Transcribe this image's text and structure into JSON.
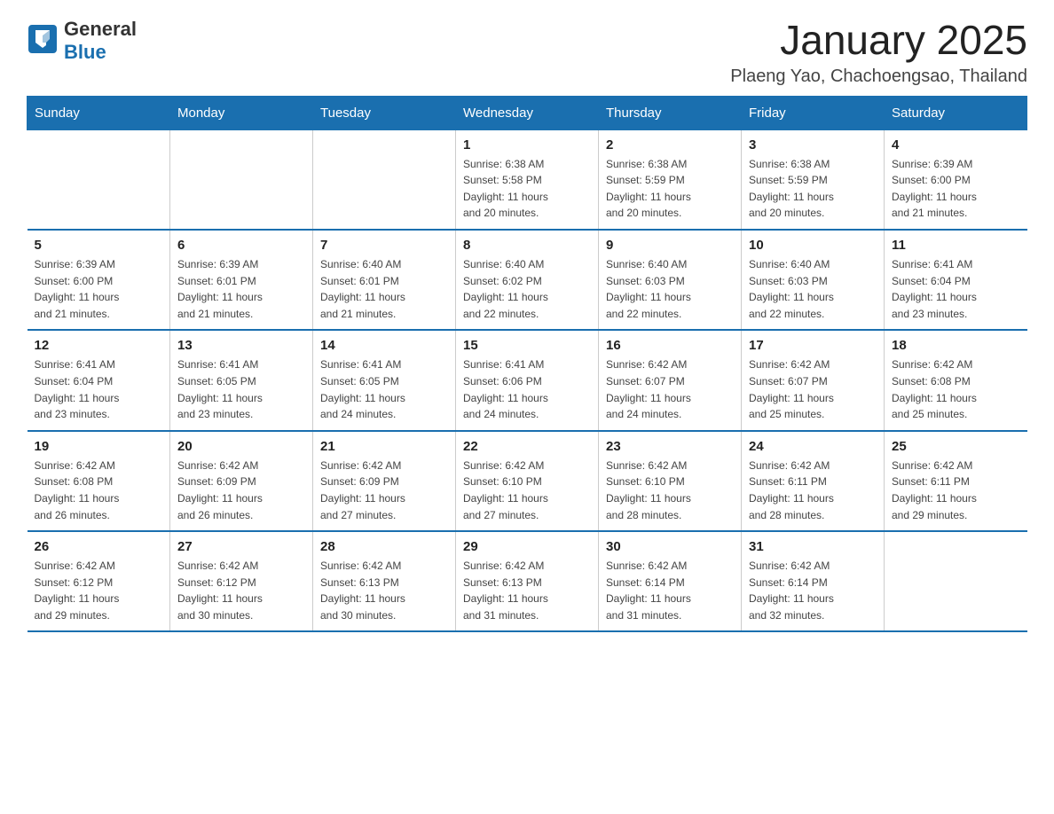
{
  "header": {
    "logo": {
      "text_general": "General",
      "text_blue": "Blue"
    },
    "title": "January 2025",
    "subtitle": "Plaeng Yao, Chachoengsao, Thailand"
  },
  "days_of_week": [
    "Sunday",
    "Monday",
    "Tuesday",
    "Wednesday",
    "Thursday",
    "Friday",
    "Saturday"
  ],
  "weeks": [
    {
      "days": [
        {
          "number": "",
          "info": ""
        },
        {
          "number": "",
          "info": ""
        },
        {
          "number": "",
          "info": ""
        },
        {
          "number": "1",
          "info": "Sunrise: 6:38 AM\nSunset: 5:58 PM\nDaylight: 11 hours\nand 20 minutes."
        },
        {
          "number": "2",
          "info": "Sunrise: 6:38 AM\nSunset: 5:59 PM\nDaylight: 11 hours\nand 20 minutes."
        },
        {
          "number": "3",
          "info": "Sunrise: 6:38 AM\nSunset: 5:59 PM\nDaylight: 11 hours\nand 20 minutes."
        },
        {
          "number": "4",
          "info": "Sunrise: 6:39 AM\nSunset: 6:00 PM\nDaylight: 11 hours\nand 21 minutes."
        }
      ]
    },
    {
      "days": [
        {
          "number": "5",
          "info": "Sunrise: 6:39 AM\nSunset: 6:00 PM\nDaylight: 11 hours\nand 21 minutes."
        },
        {
          "number": "6",
          "info": "Sunrise: 6:39 AM\nSunset: 6:01 PM\nDaylight: 11 hours\nand 21 minutes."
        },
        {
          "number": "7",
          "info": "Sunrise: 6:40 AM\nSunset: 6:01 PM\nDaylight: 11 hours\nand 21 minutes."
        },
        {
          "number": "8",
          "info": "Sunrise: 6:40 AM\nSunset: 6:02 PM\nDaylight: 11 hours\nand 22 minutes."
        },
        {
          "number": "9",
          "info": "Sunrise: 6:40 AM\nSunset: 6:03 PM\nDaylight: 11 hours\nand 22 minutes."
        },
        {
          "number": "10",
          "info": "Sunrise: 6:40 AM\nSunset: 6:03 PM\nDaylight: 11 hours\nand 22 minutes."
        },
        {
          "number": "11",
          "info": "Sunrise: 6:41 AM\nSunset: 6:04 PM\nDaylight: 11 hours\nand 23 minutes."
        }
      ]
    },
    {
      "days": [
        {
          "number": "12",
          "info": "Sunrise: 6:41 AM\nSunset: 6:04 PM\nDaylight: 11 hours\nand 23 minutes."
        },
        {
          "number": "13",
          "info": "Sunrise: 6:41 AM\nSunset: 6:05 PM\nDaylight: 11 hours\nand 23 minutes."
        },
        {
          "number": "14",
          "info": "Sunrise: 6:41 AM\nSunset: 6:05 PM\nDaylight: 11 hours\nand 24 minutes."
        },
        {
          "number": "15",
          "info": "Sunrise: 6:41 AM\nSunset: 6:06 PM\nDaylight: 11 hours\nand 24 minutes."
        },
        {
          "number": "16",
          "info": "Sunrise: 6:42 AM\nSunset: 6:07 PM\nDaylight: 11 hours\nand 24 minutes."
        },
        {
          "number": "17",
          "info": "Sunrise: 6:42 AM\nSunset: 6:07 PM\nDaylight: 11 hours\nand 25 minutes."
        },
        {
          "number": "18",
          "info": "Sunrise: 6:42 AM\nSunset: 6:08 PM\nDaylight: 11 hours\nand 25 minutes."
        }
      ]
    },
    {
      "days": [
        {
          "number": "19",
          "info": "Sunrise: 6:42 AM\nSunset: 6:08 PM\nDaylight: 11 hours\nand 26 minutes."
        },
        {
          "number": "20",
          "info": "Sunrise: 6:42 AM\nSunset: 6:09 PM\nDaylight: 11 hours\nand 26 minutes."
        },
        {
          "number": "21",
          "info": "Sunrise: 6:42 AM\nSunset: 6:09 PM\nDaylight: 11 hours\nand 27 minutes."
        },
        {
          "number": "22",
          "info": "Sunrise: 6:42 AM\nSunset: 6:10 PM\nDaylight: 11 hours\nand 27 minutes."
        },
        {
          "number": "23",
          "info": "Sunrise: 6:42 AM\nSunset: 6:10 PM\nDaylight: 11 hours\nand 28 minutes."
        },
        {
          "number": "24",
          "info": "Sunrise: 6:42 AM\nSunset: 6:11 PM\nDaylight: 11 hours\nand 28 minutes."
        },
        {
          "number": "25",
          "info": "Sunrise: 6:42 AM\nSunset: 6:11 PM\nDaylight: 11 hours\nand 29 minutes."
        }
      ]
    },
    {
      "days": [
        {
          "number": "26",
          "info": "Sunrise: 6:42 AM\nSunset: 6:12 PM\nDaylight: 11 hours\nand 29 minutes."
        },
        {
          "number": "27",
          "info": "Sunrise: 6:42 AM\nSunset: 6:12 PM\nDaylight: 11 hours\nand 30 minutes."
        },
        {
          "number": "28",
          "info": "Sunrise: 6:42 AM\nSunset: 6:13 PM\nDaylight: 11 hours\nand 30 minutes."
        },
        {
          "number": "29",
          "info": "Sunrise: 6:42 AM\nSunset: 6:13 PM\nDaylight: 11 hours\nand 31 minutes."
        },
        {
          "number": "30",
          "info": "Sunrise: 6:42 AM\nSunset: 6:14 PM\nDaylight: 11 hours\nand 31 minutes."
        },
        {
          "number": "31",
          "info": "Sunrise: 6:42 AM\nSunset: 6:14 PM\nDaylight: 11 hours\nand 32 minutes."
        },
        {
          "number": "",
          "info": ""
        }
      ]
    }
  ]
}
